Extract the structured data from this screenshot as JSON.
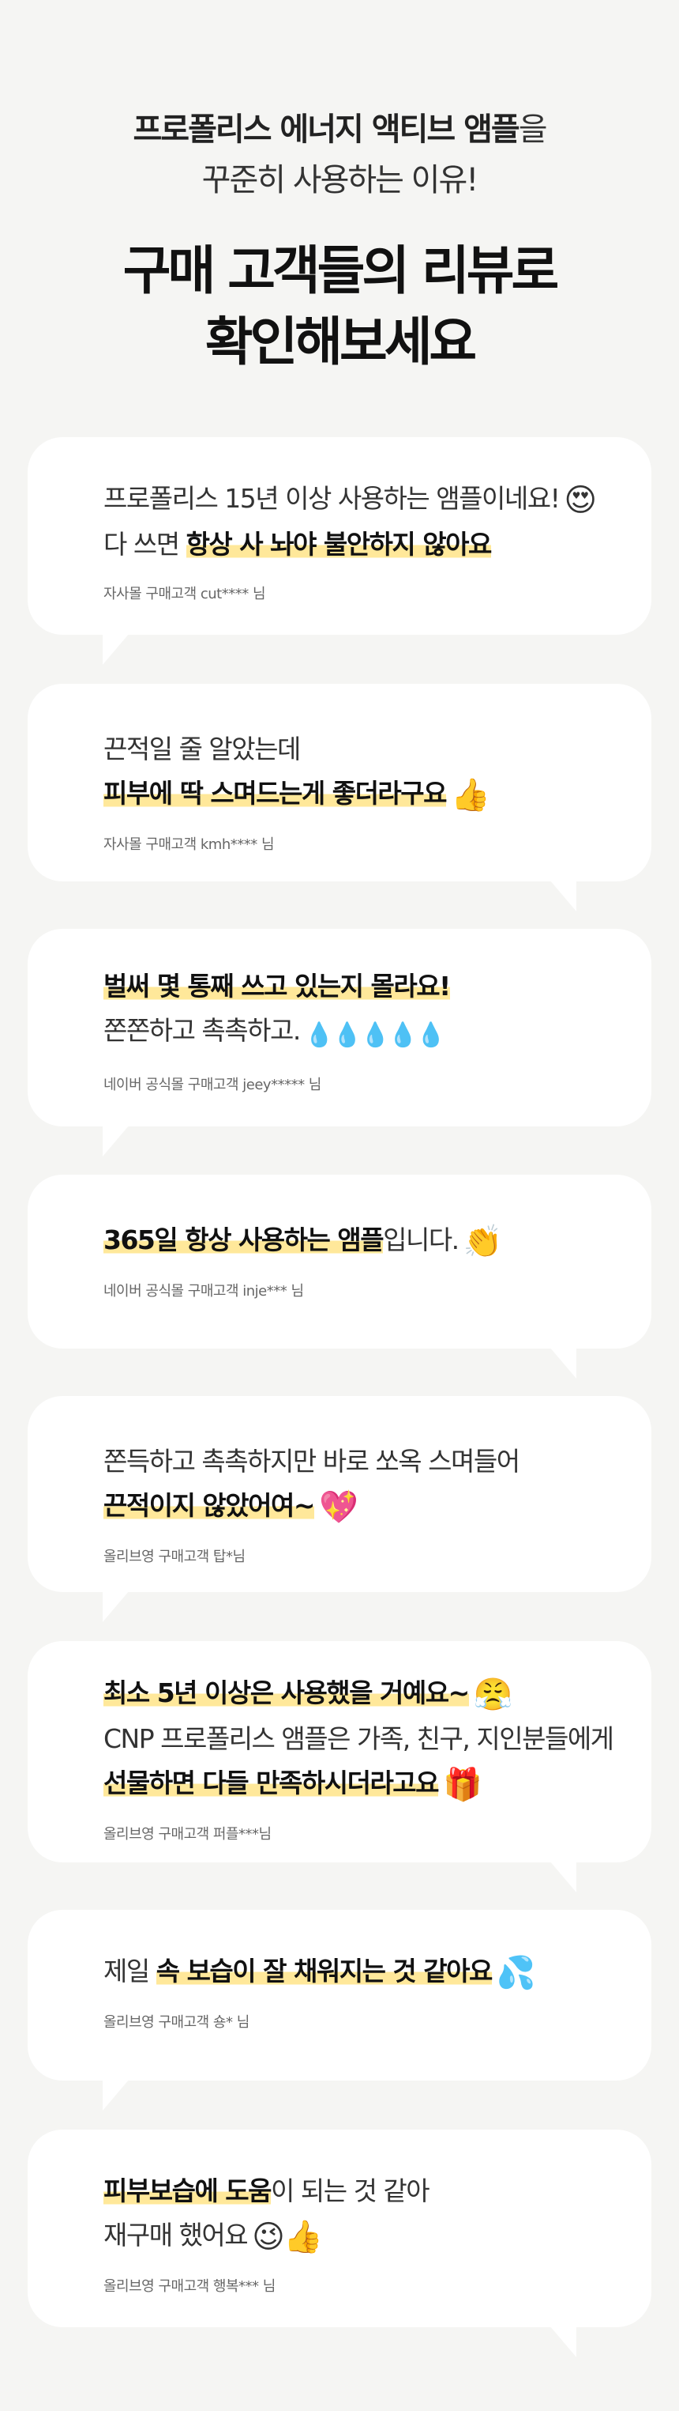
{
  "header": {
    "intro_bold": "프로폴리스 에너지 액티브 앰플",
    "intro_rest": "을",
    "intro_line2": "꾸준히 사용하는 이유!",
    "headline_line1": "구매 고객들의 리뷰로",
    "headline_line2": "확인해보세요"
  },
  "reviews": [
    {
      "line1_text": "프로폴리스 15년 이상 사용하는 앰플이네요!",
      "line1_emoji": "😍",
      "line2_pre": "다 쓰면 ",
      "line2_hl": "항상 사 놔야 불안하지 않아요",
      "author": "자사몰 구매고객 cut**** 님"
    },
    {
      "line1_text": "끈적일 줄 알았는데",
      "line2_hl": "피부에 딱 스며드는게 좋더라구요",
      "line2_emoji": "👍",
      "author": "자사몰 구매고객 kmh**** 님"
    },
    {
      "line1_hl": "벌써 몇 통째 쓰고 있는지 몰라요!",
      "line2_text": "쫀쫀하고 촉촉하고.",
      "line2_emoji": "💧💧💧💧💧",
      "author": "네이버 공식몰 구매고객  jeey***** 님"
    },
    {
      "line1_hl": "365일 항상 사용하는 앰플",
      "line1_text": "입니다.",
      "line1_emoji": "👏",
      "author": "네이버 공식몰 구매고객 inje*** 님"
    },
    {
      "line1_text": "쫀득하고 촉촉하지만 바로 쏘옥 스며들어",
      "line2_hl": "끈적이지 않았어여~",
      "line2_emoji": "💖",
      "author": "올리브영 구매고객 탑*님"
    },
    {
      "line1_hl": "최소 5년 이상은 사용했을 거예요~",
      "line1_emoji": "😤",
      "line2_text": "CNP 프로폴리스 앰플은 가족, 친구, 지인분들에게",
      "line3_hl": "선물하면 다들 만족하시더라고요",
      "line3_emoji": "🎁",
      "author": "올리브영 구매고객 퍼플***님"
    },
    {
      "line1_pre": "제일 ",
      "line1_hl": "속 보습이 잘 채워지는 것 같아요",
      "line1_emoji": "💦",
      "author": "올리브영 구매고객 숑* 님"
    },
    {
      "line1_hl": "피부보습에 도움",
      "line1_text": "이 되는 것 같아",
      "line2_text": "재구매 했어요",
      "line2_emoji": "😉👍",
      "author": "올리브영 구매고객 행복*** 님"
    }
  ]
}
